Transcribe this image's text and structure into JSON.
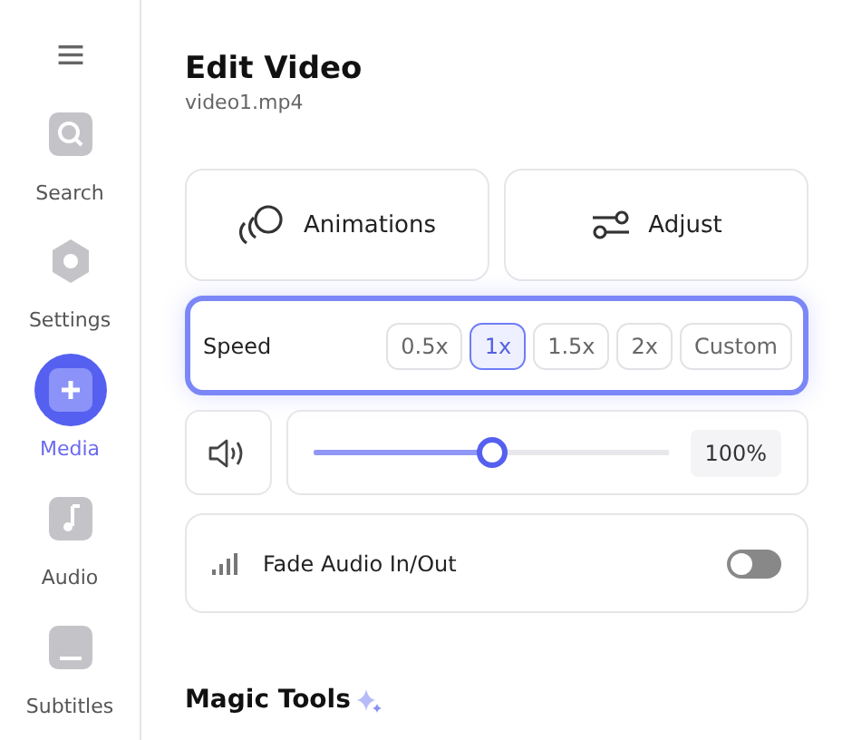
{
  "sidebar": {
    "items": [
      {
        "kind": "search",
        "label": "Search",
        "selected": false
      },
      {
        "kind": "settings",
        "label": "Settings",
        "selected": false
      },
      {
        "kind": "media",
        "label": "Media",
        "selected": true
      },
      {
        "kind": "audio",
        "label": "Audio",
        "selected": false
      },
      {
        "kind": "subtitles",
        "label": "Subtitles",
        "selected": false
      }
    ]
  },
  "header": {
    "title": "Edit Video",
    "filename": "video1.mp4"
  },
  "actions": [
    {
      "kind": "animations",
      "label": "Animations"
    },
    {
      "kind": "adjust",
      "label": "Adjust"
    }
  ],
  "speed": {
    "label": "Speed",
    "options": [
      {
        "label": "0.5x",
        "selected": false
      },
      {
        "label": "1x",
        "selected": true
      },
      {
        "label": "1.5x",
        "selected": false
      },
      {
        "label": "2x",
        "selected": false
      },
      {
        "label": "Custom",
        "selected": false
      }
    ]
  },
  "volume": {
    "level": 0.5,
    "reading": "100%"
  },
  "fade": {
    "label": "Fade Audio In/Out",
    "on": false
  },
  "magic_tools": {
    "title": "Magic Tools"
  }
}
